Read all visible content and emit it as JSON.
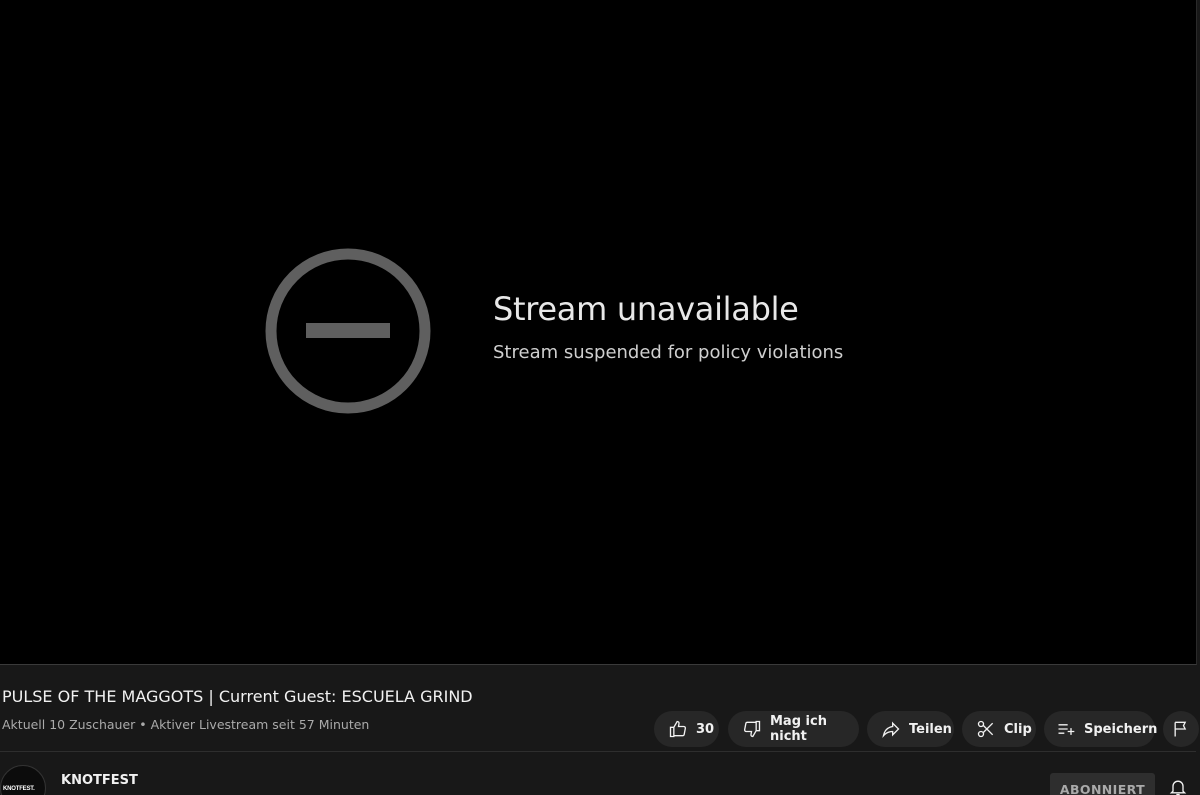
{
  "player": {
    "title": "Stream unavailable",
    "subtitle": "Stream suspended for policy violations",
    "icon": "circle-minus-icon"
  },
  "video": {
    "title": "PULSE OF THE MAGGOTS | Current Guest: ESCUELA GRIND",
    "info": "Aktuell 10 Zuschauer • Aktiver Livestream seit 57 Minuten"
  },
  "actions": {
    "like_count": "30",
    "dislike_label": "Mag ich nicht",
    "share_label": "Teilen",
    "clip_label": "Clip",
    "save_label": "Speichern"
  },
  "channel": {
    "name": "KNOTFEST",
    "avatar_text": "KNOTFEST.",
    "subscribe_label": "ABONNIERT"
  },
  "colors": {
    "background": "#181818",
    "player": "#000000",
    "pill": "#272727",
    "icon_gray": "#5f5f5f"
  }
}
